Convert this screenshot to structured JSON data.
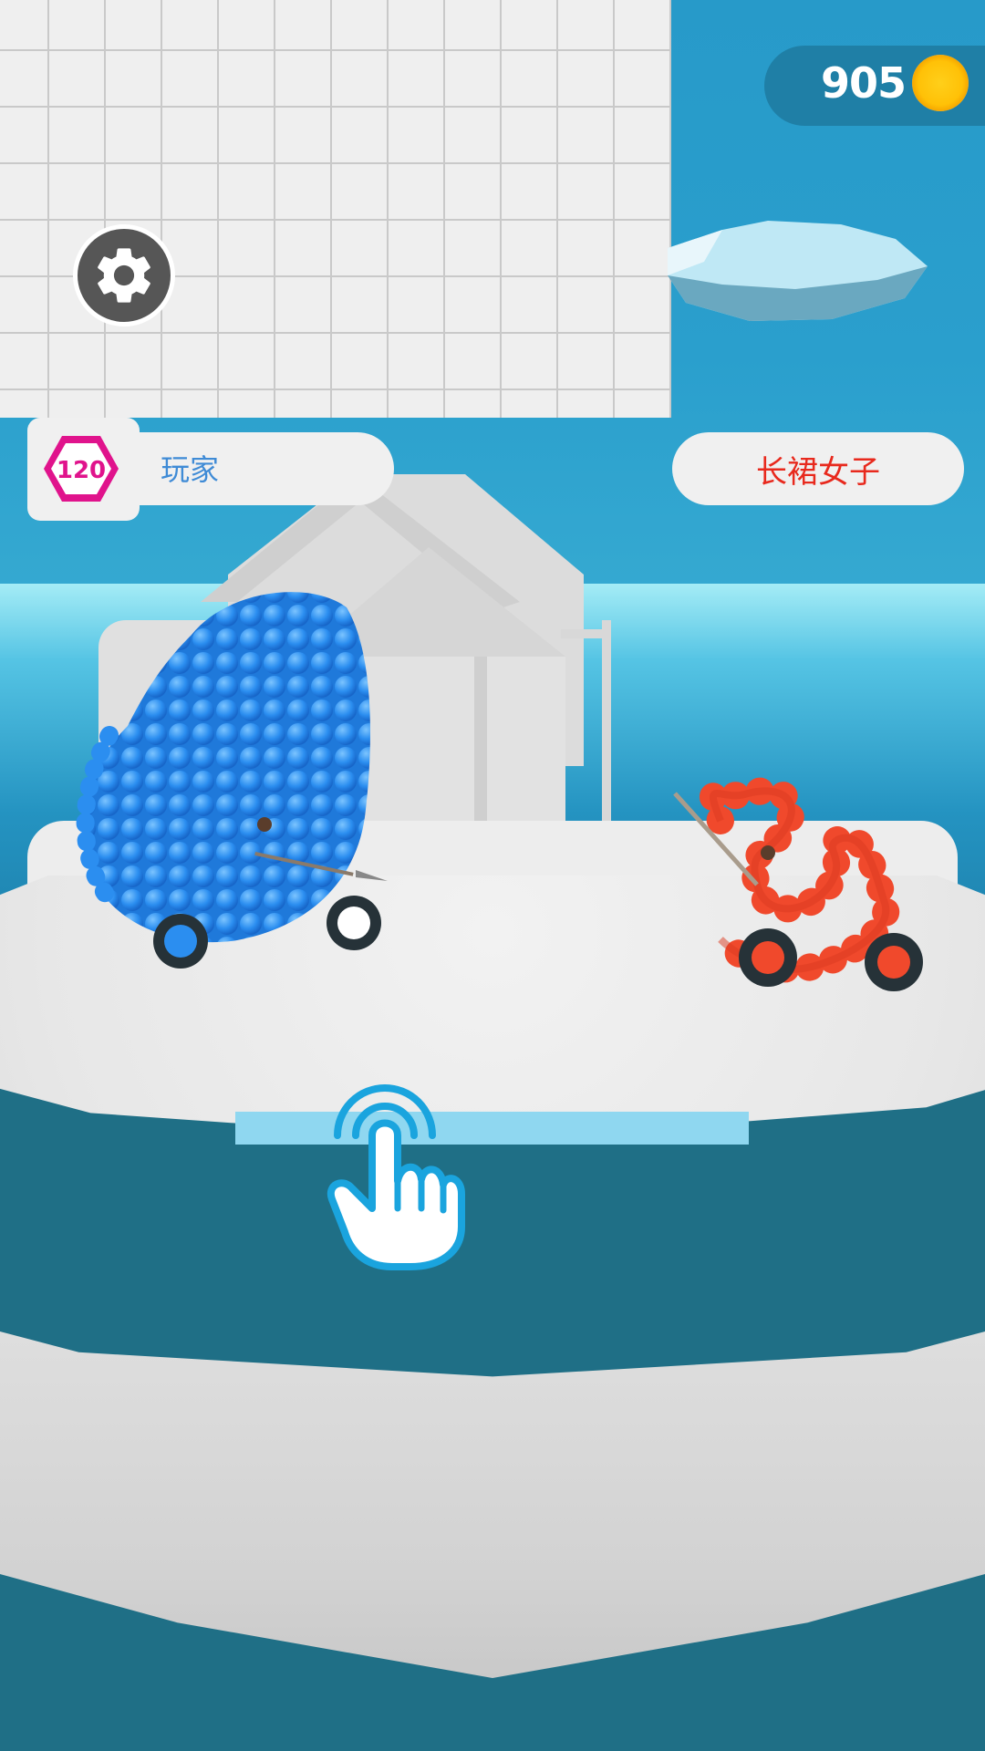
{
  "hud": {
    "coins": "905",
    "coin_icon": "coin-icon",
    "settings_icon": "gear-icon"
  },
  "player": {
    "level": "120",
    "name": "玩家"
  },
  "enemy": {
    "name": "长裙女子"
  },
  "tutorial": {
    "hint_icon": "tap-hand-icon",
    "slider_color": "#8fd7f0"
  },
  "colors": {
    "sky": "#279ac9",
    "player_blue": "#2b8ef0",
    "enemy_red": "#f0492c",
    "badge_pink": "#e0138c"
  }
}
